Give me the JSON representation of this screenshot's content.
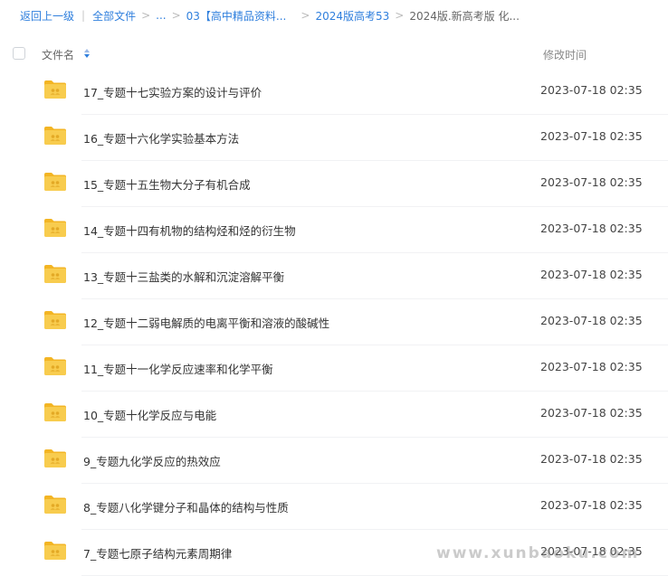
{
  "breadcrumb": {
    "back": "返回上一级",
    "items": [
      "全部文件",
      "...",
      "03【高中精品资料...",
      "2024版高考53",
      "2024版.新高考版 化..."
    ]
  },
  "table": {
    "col_name": "文件名",
    "col_time": "修改时间"
  },
  "files": [
    {
      "name": "17_专题十七实验方案的设计与评价",
      "time": "2023-07-18 02:35"
    },
    {
      "name": "16_专题十六化学实验基本方法",
      "time": "2023-07-18 02:35"
    },
    {
      "name": "15_专题十五生物大分子有机合成",
      "time": "2023-07-18 02:35"
    },
    {
      "name": "14_专题十四有机物的结构烃和烃的衍生物",
      "time": "2023-07-18 02:35"
    },
    {
      "name": "13_专题十三盐类的水解和沉淀溶解平衡",
      "time": "2023-07-18 02:35"
    },
    {
      "name": "12_专题十二弱电解质的电离平衡和溶液的酸碱性",
      "time": "2023-07-18 02:35"
    },
    {
      "name": "11_专题十一化学反应速率和化学平衡",
      "time": "2023-07-18 02:35"
    },
    {
      "name": "10_专题十化学反应与电能",
      "time": "2023-07-18 02:35"
    },
    {
      "name": "9_专题九化学反应的热效应",
      "time": "2023-07-18 02:35"
    },
    {
      "name": "8_专题八化学键分子和晶体的结构与性质",
      "time": "2023-07-18 02:35"
    },
    {
      "name": "7_专题七原子结构元素周期律",
      "time": "2023-07-18 02:35"
    }
  ],
  "watermark": "www.xunbaoku.com",
  "colors": {
    "link": "#2f7fdd",
    "folder": "#f7c948"
  }
}
